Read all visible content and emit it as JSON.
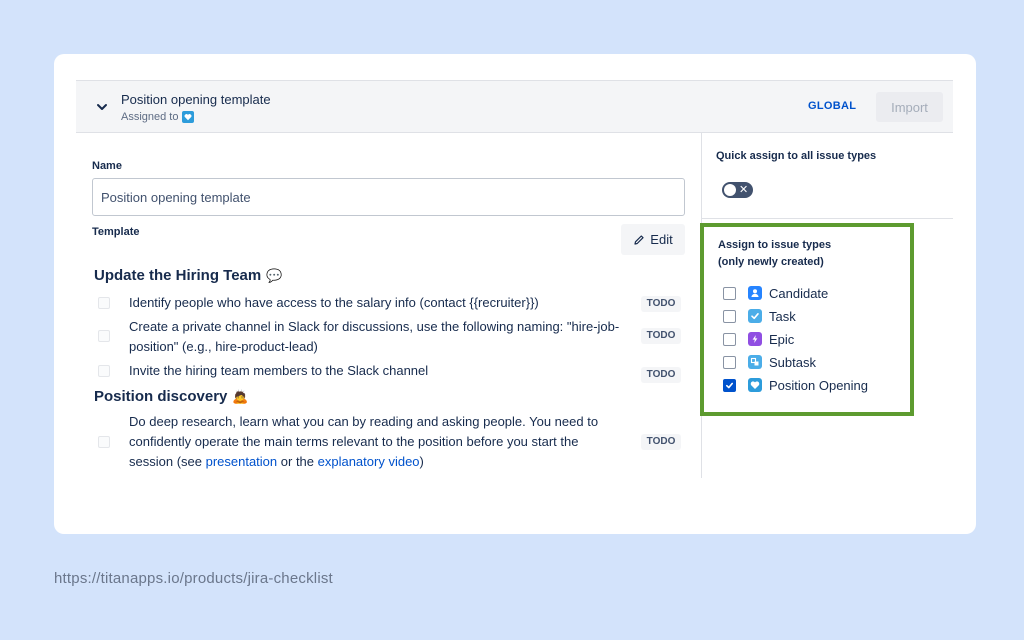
{
  "header": {
    "title": "Position opening template",
    "assigned_label": "Assigned to",
    "scope": "GLOBAL",
    "import_label": "Import"
  },
  "form": {
    "name_label": "Name",
    "name_value": "Position opening template",
    "template_label": "Template",
    "edit_label": "Edit"
  },
  "sections": [
    {
      "title": "Update the Hiring Team",
      "emoji": "💬",
      "items": [
        {
          "text": "Identify people who have access to the salary info (contact {{recruiter}})",
          "status": "TODO"
        },
        {
          "text": "Create a private channel in Slack for discussions, use the following naming: \"hire-job-position\" (e.g., hire-product-lead)",
          "status": "TODO"
        },
        {
          "text": "Invite the hiring team members to the Slack channel",
          "status": "TODO"
        }
      ]
    },
    {
      "title": "Position discovery",
      "emoji": "🙇",
      "items": [
        {
          "text_before": "Do deep research, learn what you can by reading and asking people. You need to confidently operate the main terms relevant to the position before you start the session (see ",
          "link1": "presentation",
          "text_mid": " or the ",
          "link2": "explanatory video",
          "text_after": ")",
          "status": "TODO"
        }
      ]
    }
  ],
  "quick_assign": {
    "label": "Quick assign to all issue types",
    "enabled": false
  },
  "assign": {
    "title_line1": "Assign to issue types",
    "title_line2": "(only newly created)",
    "types": [
      {
        "label": "Candidate",
        "checked": false,
        "icon": "person-icon",
        "color": "#2684ff"
      },
      {
        "label": "Task",
        "checked": false,
        "icon": "checkmark-icon",
        "color": "#4bade8"
      },
      {
        "label": "Epic",
        "checked": false,
        "icon": "lightning-icon",
        "color": "#904ee2"
      },
      {
        "label": "Subtask",
        "checked": false,
        "icon": "subtask-icon",
        "color": "#4bade8"
      },
      {
        "label": "Position Opening",
        "checked": true,
        "icon": "heart-icon",
        "color": "#2d9cdb"
      }
    ]
  },
  "footer": {
    "url": "https://titanapps.io/products/jira-checklist"
  }
}
